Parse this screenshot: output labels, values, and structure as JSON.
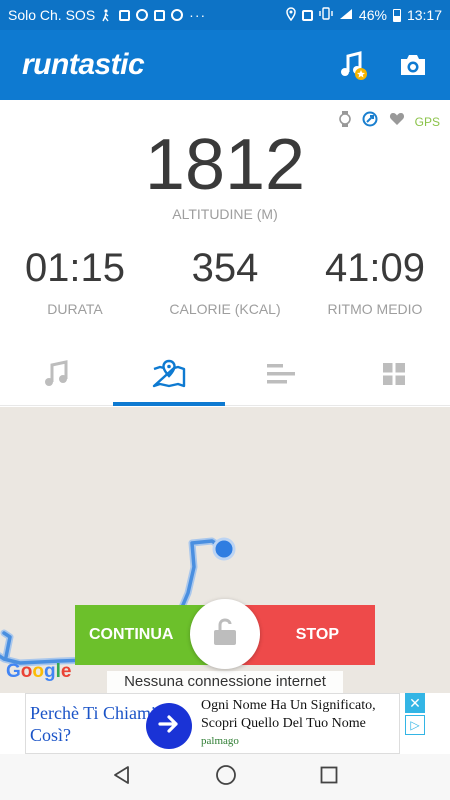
{
  "status_bar": {
    "carrier": "Solo Ch. SOS",
    "battery": "46%",
    "time": "13:17"
  },
  "app": {
    "logo": "runtastic"
  },
  "top_indicators": {
    "gps": "GPS"
  },
  "main_metric": {
    "value": "1812",
    "label": "ALTITUDINE (M)"
  },
  "metrics": [
    {
      "value": "01:15",
      "label": "DURATA"
    },
    {
      "value": "354",
      "label": "CALORIE (KCAL)"
    },
    {
      "value": "41:09",
      "label": "RITMO MEDIO"
    }
  ],
  "tabs": [
    {
      "icon": "music-icon",
      "active": false
    },
    {
      "icon": "map-pin-icon",
      "active": true
    },
    {
      "icon": "bars-icon",
      "active": false
    },
    {
      "icon": "grid-icon",
      "active": false
    }
  ],
  "map": {
    "attribution": "Google",
    "offline_notice": "Nessuna connessione internet"
  },
  "controls": {
    "continue_label": "CONTINUA",
    "stop_label": "STOP"
  },
  "ad": {
    "question": "Perchè Ti Chiami Così?",
    "headline": "Ogni Nome Ha Un Significato, Scopri Quello Del Tuo Nome",
    "source": "palmago"
  },
  "colors": {
    "primary": "#0e7ad1",
    "continue": "#6cc02b",
    "stop": "#ee4a4a",
    "route": "#4a8fe0"
  }
}
